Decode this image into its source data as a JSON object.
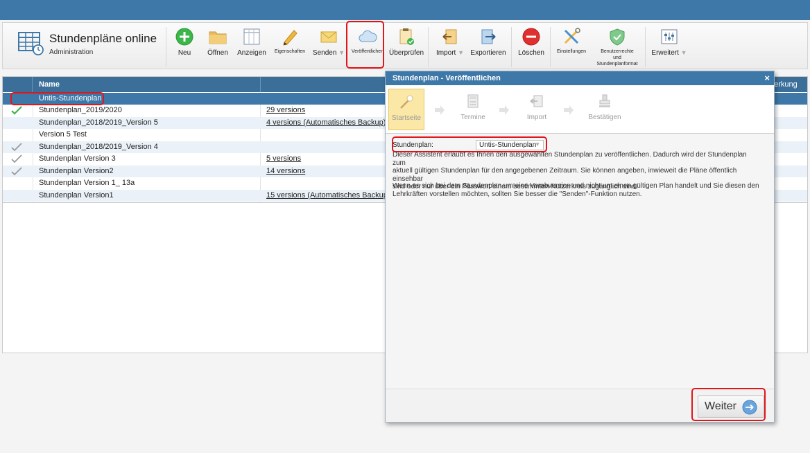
{
  "app": {
    "title": "Stundenpläne online",
    "subtitle": "Administration"
  },
  "toolbar": {
    "neu": "Neu",
    "oeffnen": "Öffnen",
    "anzeigen": "Anzeigen",
    "eigenschaften": "Eigenschaften",
    "senden": "Senden",
    "veroeffentlichen": "Veröffentlichen",
    "ueberpruefen": "Überprüfen",
    "import": "Import",
    "exportieren": "Exportieren",
    "loeschen": "Löschen",
    "einstellungen": "Einstellungen",
    "benutzerrechte_1": "Benutzerrechte",
    "benutzerrechte_2": "und",
    "benutzerrechte_3": "Stundenplanformat",
    "erweitert": "Erweitert",
    "dropdown_glyph": "▼"
  },
  "grid": {
    "header_name": "Name",
    "header_bemerkung": "nerkung",
    "rows": [
      {
        "name": "Untis-Stundenplan",
        "versions": ""
      },
      {
        "name": "Stundenplan_2019/2020",
        "versions": "29 versions"
      },
      {
        "name": "Stundenplan_2018/2019_Version 5",
        "versions": "4 versions (Automatisches Backup)"
      },
      {
        "name": "Version 5 Test",
        "versions": ""
      },
      {
        "name": "Stundenplan_2018/2019_Version 4",
        "versions": ""
      },
      {
        "name": "Stundenplan Version 3",
        "versions": "5 versions"
      },
      {
        "name": "Stundenplan Version2",
        "versions": "14 versions"
      },
      {
        "name": "Stundenplan Version 1_ 13a",
        "versions": ""
      },
      {
        "name": "Stundenplan Version1",
        "versions": "15 versions (Automatisches Backup)"
      }
    ]
  },
  "dialog": {
    "title": "Stundenplan - Veröffentlichen",
    "close": "×",
    "steps": [
      "Startseite",
      "Termine",
      "Import",
      "Bestätigen"
    ],
    "field_label": "Stundenplan:",
    "field_value": "Untis-Stundenplan",
    "paragraph1_line1": "Dieser Assistent erlaubt es Ihnen den ausgewählten Stundenplan zu veröffentlichen. Dadurch wird der Stundenplan zum",
    "paragraph1_line2": "aktuell gültigen Stundenplan für den angegebenen Zeitraum. Sie können angeben, inwieweit die Pläne öffentlich einsehbar",
    "paragraph1_line3": "sind oder nur über ein Passwort einem bestimmten Nutzerkreis zugänglich sind.",
    "paragraph2_line1": "Wenn es sich bei dem Stundenplan um eine Vorabversion und nicht um einen gültigen Plan handelt und Sie diesen den",
    "paragraph2_line2": "Lehrkräften vorstellen möchten, sollten Sie besser die \"Senden\"-Funktion nutzen.",
    "next_button": "Weiter"
  },
  "colors": {
    "header_blue": "#3e78a8",
    "highlight_red": "#e0161b",
    "active_step": "#fbe7a6"
  }
}
